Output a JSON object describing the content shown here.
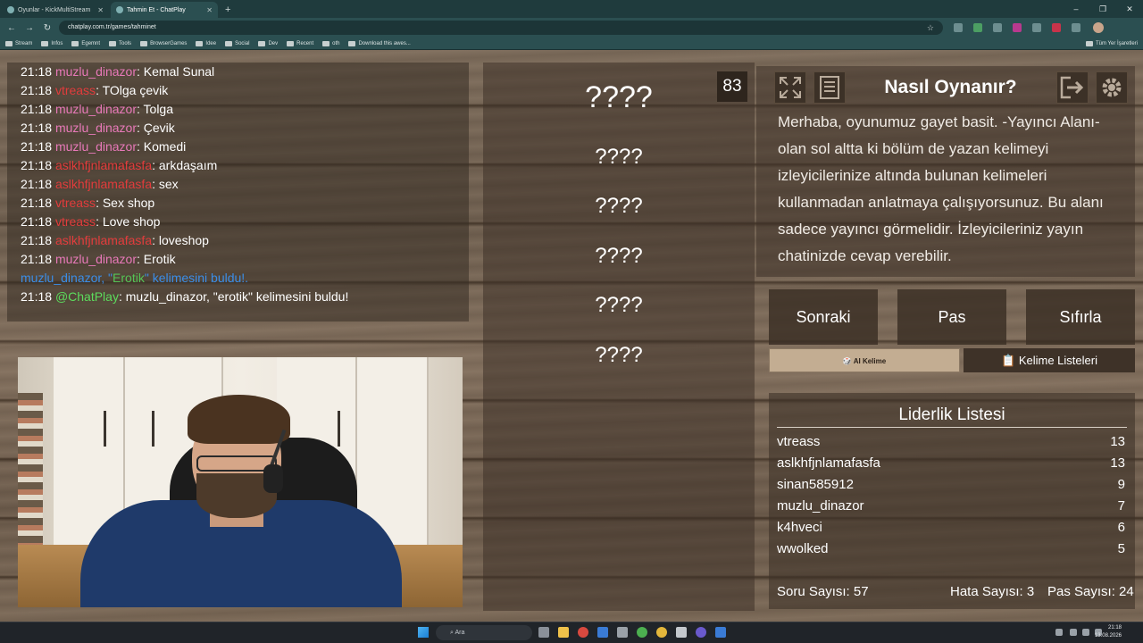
{
  "browser": {
    "tabs": [
      {
        "title": "Oyunlar - KickMultiStream"
      },
      {
        "title": "Tahmin Et - ChatPlay"
      }
    ],
    "url": "chatplay.com.tr/games/tahminet",
    "bookmarks": [
      "Stream",
      "Infos",
      "Egemnt",
      "Tools",
      "BrowserGames",
      "Idee",
      "Social",
      "Dev",
      "Recent",
      "oth",
      "Download this awes..."
    ],
    "all_bookmarks": "Tüm Yer İşaretleri"
  },
  "chat": {
    "messages": [
      {
        "time": "21:18",
        "user": "muzlu_dinazor",
        "color": "pink",
        "text": ": Kemal Sunal"
      },
      {
        "time": "21:18",
        "user": "vtreass",
        "color": "red",
        "text": ": TOlga çevik"
      },
      {
        "time": "21:18",
        "user": "muzlu_dinazor",
        "color": "pink",
        "text": ": Tolga"
      },
      {
        "time": "21:18",
        "user": "muzlu_dinazor",
        "color": "pink",
        "text": ": Çevik"
      },
      {
        "time": "21:18",
        "user": "muzlu_dinazor",
        "color": "pink",
        "text": ": Komedi"
      },
      {
        "time": "21:18",
        "user": "aslkhfjnlamafasfa",
        "color": "red",
        "text": ": arkdaşaım"
      },
      {
        "time": "21:18",
        "user": "aslkhfjnlamafasfa",
        "color": "red",
        "text": ": sex"
      },
      {
        "time": "21:18",
        "user": "vtreass",
        "color": "red",
        "text": ": Sex shop"
      },
      {
        "time": "21:18",
        "user": "vtreass",
        "color": "red",
        "text": ": Love shop"
      },
      {
        "time": "21:18",
        "user": "aslkhfjnlamafasfa",
        "color": "red",
        "text": ": loveshop"
      },
      {
        "time": "21:18",
        "user": "muzlu_dinazor",
        "color": "pink",
        "text": ": Erotik"
      }
    ],
    "system": {
      "prefix": "muzlu_dinazor, \"",
      "word": "Erotik",
      "suffix": "\" kelimesini buldu!."
    },
    "chatplay": {
      "time": "21:18",
      "user": "@ChatPlay",
      "text": ": muzlu_dinazor, \"erotik\" kelimesini buldu!"
    }
  },
  "words": {
    "main": "????",
    "others": [
      "????",
      "????",
      "????",
      "????",
      "????"
    ]
  },
  "timer": "83",
  "howto": {
    "title": "Nasıl Oynanır?",
    "text": "Merhaba, oyunumuz gayet basit. -Yayıncı Alanı- olan sol altta ki bölüm de yazan kelimeyi izleyicilerinize altında bulunan kelimeleri kullanmadan anlatmaya çalışıyorsunuz. Bu alanı sadece yayıncı görmelidir. İzleyicileriniz yayın chatinizde cevap verebilir."
  },
  "buttons": {
    "next": "Sonraki",
    "pass": "Pas",
    "reset": "Sıfırla",
    "ai_word": "🎲 AI Kelime",
    "word_lists": "📋 Kelime Listeleri"
  },
  "leaderboard": {
    "title": "Liderlik Listesi",
    "rows": [
      {
        "name": "vtreass",
        "score": "13"
      },
      {
        "name": "aslkhfjnlamafasfa",
        "score": "13"
      },
      {
        "name": "sinan585912",
        "score": "9"
      },
      {
        "name": "muzlu_dinazor",
        "score": "7"
      },
      {
        "name": "k4hveci",
        "score": "6"
      },
      {
        "name": "wwolked",
        "score": "5"
      }
    ],
    "question_count": "Soru Sayısı: 57",
    "error_count": "Hata Sayısı: 3",
    "pass_count": "Pas Sayısı: 24"
  },
  "taskbar": {
    "search": "Ara",
    "time": "21:18",
    "date": "13.08.2026"
  }
}
